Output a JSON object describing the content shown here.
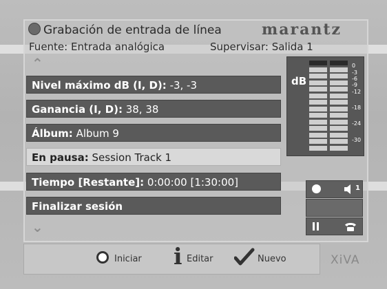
{
  "header": {
    "title": "Grabación de entrada de línea",
    "brand": "marantz",
    "source": "Fuente: Entrada analógica",
    "monitor": "Supervisar: Salida 1"
  },
  "rows": [
    {
      "label": "Nivel máximo dB (I, D):",
      "value": " -3, -3"
    },
    {
      "label": "Ganancia (I, D):",
      "value": " 38, 38"
    },
    {
      "label": "Álbum:",
      "value": " Album 9"
    },
    {
      "label": "En pausa:",
      "value": " Session Track 1"
    },
    {
      "label": "Tiempo [Restante]:",
      "value": " 0:00:00 [1:30:00]"
    },
    {
      "label": "Finalizar sesión",
      "value": ""
    }
  ],
  "meter": {
    "db_label": "dB",
    "scale": [
      "0",
      "-3",
      "-6",
      "-9",
      "-12",
      "-18",
      "-24",
      "-30"
    ]
  },
  "controls": {
    "record_icon": "record-icon",
    "volume_icon": "speaker-icon",
    "volume_value": "1",
    "pause_icon": "pause-icon",
    "phone_icon": "phone-icon"
  },
  "buttons": {
    "start": "Iniciar",
    "edit": "Editar",
    "new": "Nuevo"
  },
  "footer_logo": "XiVA"
}
